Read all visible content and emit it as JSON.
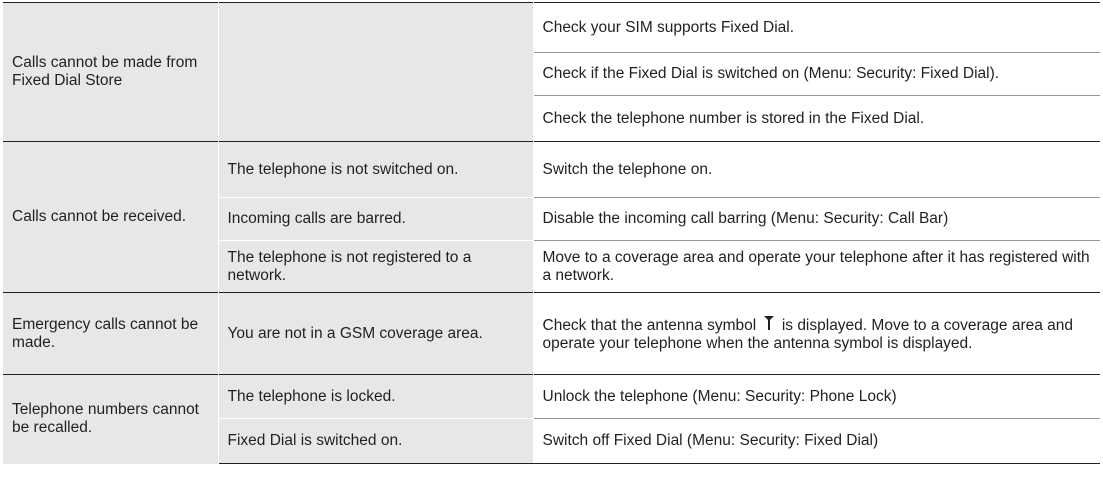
{
  "groups": [
    {
      "problem": "Calls cannot be made from Fixed Dial Store",
      "rows": [
        {
          "cause": "",
          "remedy": "Check your SIM supports Fixed Dial."
        },
        {
          "cause": "",
          "remedy": "Check if the Fixed Dial is switched on (Menu: Security: Fixed Dial)."
        },
        {
          "cause": "",
          "remedy": "Check the telephone number is stored in the Fixed Dial."
        }
      ]
    },
    {
      "problem": "Calls cannot be received.",
      "rows": [
        {
          "cause": "The telephone is not switched on.",
          "remedy": "Switch the telephone on."
        },
        {
          "cause": "Incoming calls are barred.",
          "remedy": "Disable the incoming call barring (Menu: Security: Call Bar)"
        },
        {
          "cause": "The telephone is not registered to a network.",
          "remedy": "Move to a coverage area and operate your telephone after it has registered with a network."
        }
      ]
    },
    {
      "problem": "Emergency calls cannot be made.",
      "rows": [
        {
          "cause": "You are not in a GSM coverage area.",
          "remedy_before_icon": "Check that the antenna symbol",
          "remedy_icon": "antenna-signal-icon",
          "remedy_after_icon": "is displayed. Move to a coverage area and operate your telephone when the antenna symbol is displayed."
        }
      ]
    },
    {
      "problem": "Telephone numbers cannot be recalled.",
      "rows": [
        {
          "cause": "The telephone is locked.",
          "remedy": "Unlock the telephone (Menu: Security: Phone Lock)"
        },
        {
          "cause": "Fixed Dial is switched on.",
          "remedy": "Switch off Fixed Dial (Menu: Security: Fixed Dial)"
        }
      ]
    }
  ],
  "colors": {
    "shade": "#e7e7e8",
    "text": "#231f20",
    "rule": "#231f20",
    "subrule": "#939598"
  }
}
